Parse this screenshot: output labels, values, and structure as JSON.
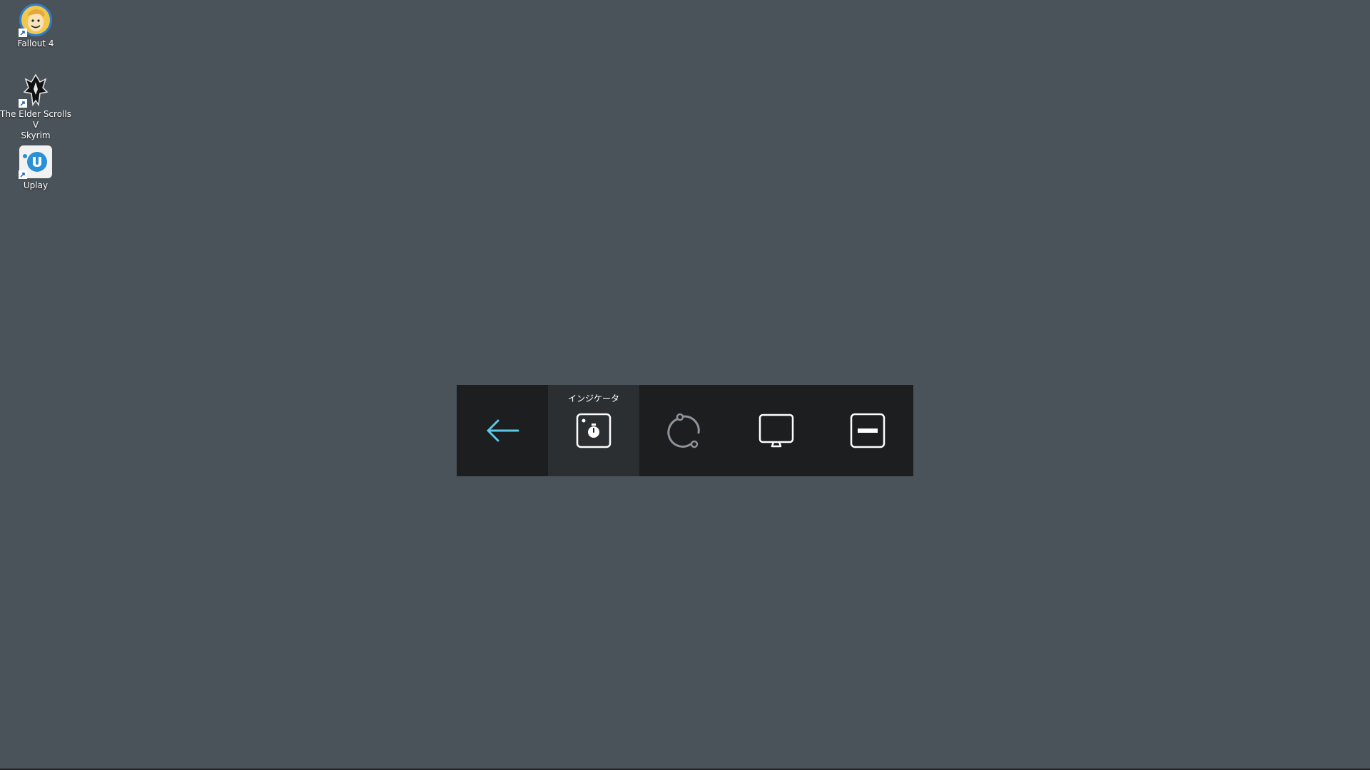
{
  "desktop": {
    "background_color": "#4b535a",
    "icons": [
      {
        "label": "Fallout 4",
        "icon": "fallout-vault-boy-icon"
      },
      {
        "label": "The Elder Scrolls V\nSkyrim",
        "icon": "skyrim-dragon-icon"
      },
      {
        "label": "Uplay",
        "icon": "uplay-icon"
      }
    ]
  },
  "toolbar": {
    "tooltip": "インジケータ",
    "buttons": [
      {
        "name": "back",
        "icon": "arrow-left-icon",
        "color": "#5bc8e8"
      },
      {
        "name": "indicator",
        "icon": "stopwatch-indicator-icon",
        "active": true
      },
      {
        "name": "sync",
        "icon": "sync-cycle-icon"
      },
      {
        "name": "display",
        "icon": "monitor-icon"
      },
      {
        "name": "minimize",
        "icon": "minus-box-icon"
      }
    ]
  }
}
